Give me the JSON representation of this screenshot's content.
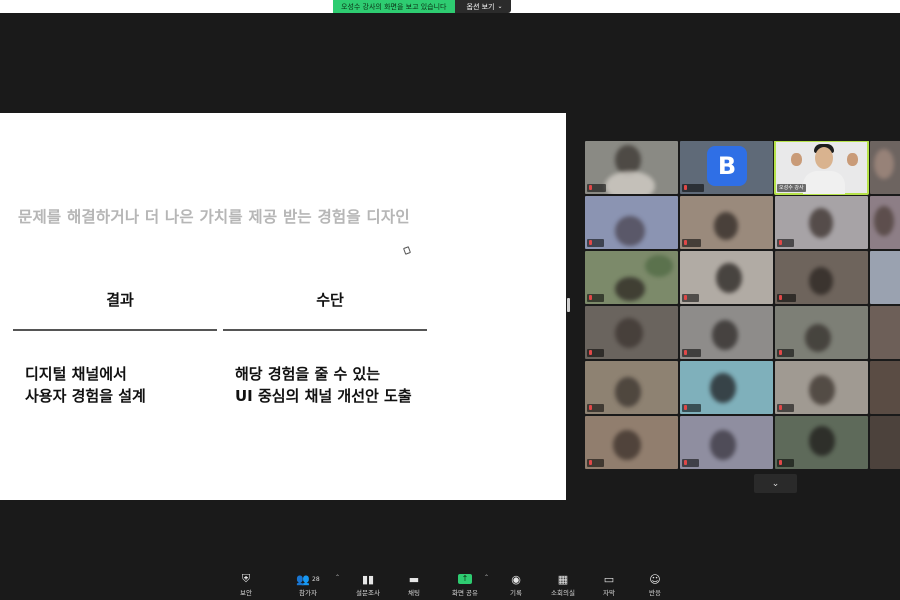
{
  "banner": {
    "status": "오성수 강사의 화면을 보고 있습니다",
    "options": "옵션 보기"
  },
  "slide": {
    "headline": "문제를 해결하거나 더 나은 가치를 제공 받는 경험을 디자인",
    "columns": [
      {
        "heading": "결과",
        "lines": [
          "디지털 채널에서",
          "사용자 경험을 설계"
        ]
      },
      {
        "heading": "수단",
        "lines": [
          "해당 경험을 줄 수 있는",
          "UI 중심의 채널 개선안 도출"
        ]
      }
    ]
  },
  "participants": {
    "host_label": "오성수 강사",
    "logo_letter": "B"
  },
  "toolbar": {
    "items": [
      {
        "label": "보안",
        "icon": "shield-icon"
      },
      {
        "label": "참가자",
        "icon": "people-icon",
        "count": "28"
      },
      {
        "label": "설문조사",
        "icon": "poll-icon"
      },
      {
        "label": "채팅",
        "icon": "chat-icon"
      },
      {
        "label": "화면 공유",
        "icon": "share-screen-icon"
      },
      {
        "label": "기록",
        "icon": "record-icon"
      },
      {
        "label": "소회의실",
        "icon": "breakout-rooms-icon"
      },
      {
        "label": "자막",
        "icon": "captions-icon"
      },
      {
        "label": "반응",
        "icon": "reactions-icon"
      }
    ]
  },
  "colors": {
    "accent_green": "#2ecc71",
    "speaker_outline": "#b6e24a",
    "background": "#1a1a1a"
  }
}
